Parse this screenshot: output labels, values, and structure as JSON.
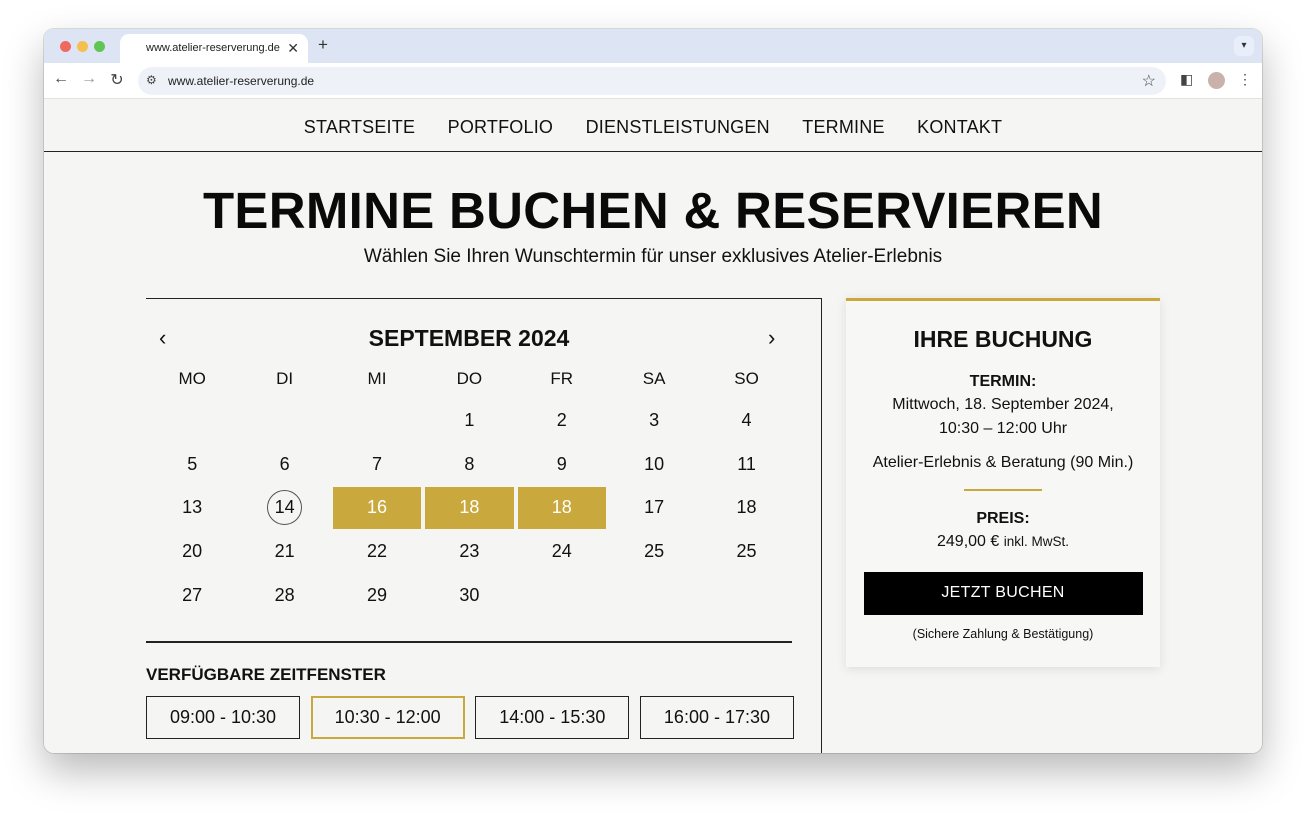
{
  "browser": {
    "tab_title": "www.atelier-reserverung.de",
    "tab_close": "✕",
    "new_tab": "+",
    "url": "www.atelier-reserverung.de",
    "icons": [
      "back-icon",
      "forward-icon",
      "reload-icon",
      "site-info-icon",
      "bookmark-star-icon",
      "side-panel-icon",
      "profile-avatar",
      "menu-icon"
    ]
  },
  "nav": {
    "items": [
      "STARTSEITE",
      "PORTFOLIO",
      "DIENSTLEISTUNGEN",
      "TERMINE",
      "KONTAKT"
    ]
  },
  "hero": {
    "title": "TERMINE BUCHEN & RESERVIEREN",
    "subtitle": "Wählen Sie Ihren Wunschtermin für unser exklusives Atelier-Erlebnis"
  },
  "calendar": {
    "prev": "‹",
    "next": "›",
    "month": "SEPTEMBER 2024",
    "weekdays": [
      "MO",
      "DI",
      "MI",
      "DO",
      "FR",
      "SA",
      "SO"
    ],
    "weeks": [
      [
        "",
        "",
        "",
        "1",
        "2",
        "3",
        "4"
      ],
      [
        "5",
        "6",
        "7",
        "8",
        "9",
        "10",
        "11"
      ],
      [
        "13",
        "14",
        "16",
        "18",
        "18",
        "17",
        "18"
      ],
      [
        "20",
        "21",
        "22",
        "23",
        "24",
        "25",
        "25"
      ],
      [
        "27",
        "28",
        "29",
        "30",
        "",
        "",
        ""
      ]
    ],
    "today": "14",
    "selected_cells": [
      [
        2,
        2
      ],
      [
        2,
        3
      ],
      [
        2,
        4
      ]
    ],
    "slots_title": "VERFÜGBARE ZEITFENSTER",
    "slots": [
      "09:00 - 10:30",
      "10:30 - 12:00",
      "14:00 - 15:30",
      "16:00 - 17:30"
    ],
    "active_slot": "10:30 - 12:00"
  },
  "booking": {
    "title": "IHRE BUCHUNG",
    "termin_label": "TERMIN:",
    "termin_line1": "Mittwoch, 18. September 2024,",
    "termin_line2": "10:30 – 12:00 Uhr",
    "service": "Atelier-Erlebnis & Beratung (90 Min.)",
    "price_label": "PREIS:",
    "price": "249,00 €",
    "price_note": "inkl. MwSt.",
    "button": "JETZT BUCHEN",
    "note": "(Sichere Zahlung & Bestätigung)"
  },
  "colors": {
    "accent": "#c9a93e",
    "text": "#111111",
    "button": "#000000",
    "background": "#f5f5f3"
  }
}
